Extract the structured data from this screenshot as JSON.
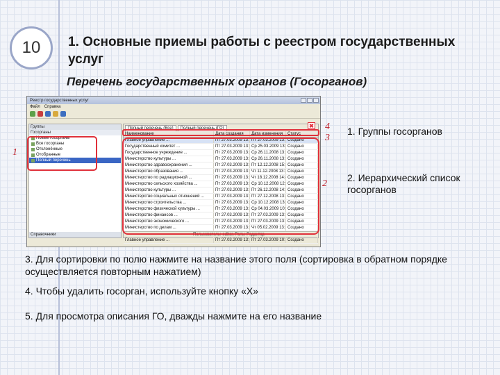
{
  "slide": {
    "number": "10",
    "title": "1. Основные приемы работы с реестром государственных услуг",
    "subtitle": "Перечень государственных органов (Госорганов)"
  },
  "window": {
    "title": "Реестр государственных услуг",
    "menu": [
      "Файл",
      "Справка"
    ],
    "left_header": "Группы",
    "left_subheader": "Госорганы",
    "left_items": [
      "Новые госорганы",
      "Все госорганы",
      "Отклонённые",
      "Отобранные",
      "Полный перечень"
    ],
    "left_footer": "Справочники",
    "tabs": [
      "Полный перечень (Все)",
      "Полный перечень (ГО)"
    ],
    "columns": [
      "Наименование",
      "Дата создания",
      "Дата изменения",
      "Статус"
    ],
    "rows": [
      [
        "Главное управление ...",
        "Пт 27.03.2009 13:52",
        "Пт 27.03.2009 13:58",
        "Создано"
      ],
      [
        "Государственный комитет ...",
        "Пт 27.03.2009 13:52",
        "Ср 25.03.2009 13:08",
        "Создано"
      ],
      [
        "Государственное учреждение ...",
        "Пт 27.03.2009 13:52",
        "Ср 26.11.2008 13:08",
        "Создано"
      ],
      [
        "Министерство культуры ...",
        "Пт 27.03.2009 13:52",
        "Ср 26.11.2008 13:10",
        "Создано"
      ],
      [
        "Министерство здравоохранения ...",
        "Пт 27.03.2009 13:52",
        "Пт 12.12.2008 15:57",
        "Создано"
      ],
      [
        "Министерство образования ...",
        "Пт 27.03.2009 13:52",
        "Чт 11.12.2008 13:16",
        "Создано"
      ],
      [
        "Министерство по радиационной ...",
        "Пт 27.03.2009 13:52",
        "Чт 18.12.2008 14:40",
        "Создано"
      ],
      [
        "Министерство сельского хозяйства ...",
        "Пт 27.03.2009 13:52",
        "Ср 10.12.2008 12:03",
        "Создано"
      ],
      [
        "Министерство культуры ...",
        "Пт 27.03.2009 13:52",
        "Пт 26.12.2008 14:38",
        "Создано"
      ],
      [
        "Министерство социальных отношений ...",
        "Пт 27.03.2009 13:52",
        "Пт 27.12.2008 13:42",
        "Создано"
      ],
      [
        "Министерство строительства ...",
        "Пт 27.03.2009 13:52",
        "Ср 10.12.2008 13:42",
        "Создано"
      ],
      [
        "Министерство физической культуры ...",
        "Пт 27.03.2009 13:52",
        "Ср 04.03.2009 10:53",
        "Создано"
      ],
      [
        "Министерство финансов ...",
        "Пт 27.03.2009 13:52",
        "Пт 27.03.2009 13:38",
        "Создано"
      ],
      [
        "Министерство экономического ...",
        "Пт 27.03.2009 13:52",
        "Пт 27.03.2009 13:53",
        "Создано"
      ],
      [
        "Министерство по делам ...",
        "Пт 27.03.2009 13:52",
        "Чт 05.02.2009 13:31",
        "Создано"
      ],
      [
        "Правительство Челябинской ...",
        "Пт 27.03.2009 13:52",
        "Вт 16.12.2008 10:22",
        "Создано"
      ],
      [
        "Главное управление ...",
        "Пт 27.03.2009 13:52",
        "Пт 27.03.2009 10:50",
        "Создано"
      ]
    ],
    "status_bar": "Пользователь: editor, Роль: Редактор"
  },
  "markers": {
    "m1": "1",
    "m2": "2",
    "m3": "3",
    "m4": "4",
    "x": "✖"
  },
  "annotations": {
    "groups": "1. Группы госорганов",
    "hierarchy": "2. Иерархический список госорганов"
  },
  "paragraphs": [
    "3. Для сортировки по полю нажмите на название этого поля (сортировка в обратном порядке осуществляется повторным нажатием)",
    "4. Чтобы удалить госорган, используйте кнопку «Х»",
    "5. Для просмотра описания ГО, дважды нажмите  на его название"
  ]
}
